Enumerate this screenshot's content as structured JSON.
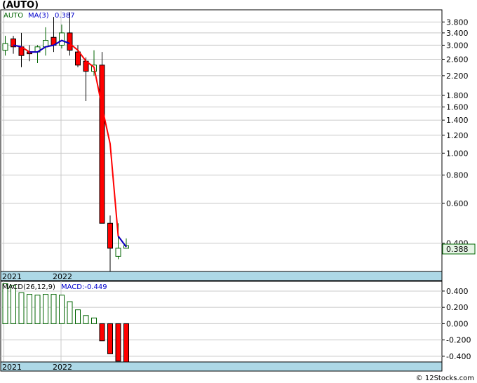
{
  "page": {
    "title": "(AUTO)",
    "copyright": "© 12Stocks.com"
  },
  "chart_data": [
    {
      "type": "candlestick",
      "scale": "log",
      "legend": {
        "symbol": "AUTO",
        "ma_label": "MA(3)",
        "ma_value": "0.387"
      },
      "last_price_label": "0.388",
      "ylim": [
        0.3,
        4.3
      ],
      "yticks": [
        "3.800",
        "3.400",
        "3.000",
        "2.600",
        "2.200",
        "1.800",
        "1.600",
        "1.400",
        "1.200",
        "1.000",
        "0.800",
        "0.600",
        "0.400"
      ],
      "ytick_values": [
        3.8,
        3.4,
        3.0,
        2.6,
        2.2,
        1.8,
        1.6,
        1.4,
        1.2,
        1.0,
        0.8,
        0.6,
        0.4
      ],
      "xticks": [
        "2021",
        "2022"
      ],
      "candles": [
        {
          "o": 2.85,
          "h": 3.3,
          "l": 2.7,
          "c": 3.05
        },
        {
          "o": 3.2,
          "h": 3.3,
          "l": 2.75,
          "c": 2.95
        },
        {
          "o": 2.95,
          "h": 3.4,
          "l": 2.4,
          "c": 2.7
        },
        {
          "o": 2.8,
          "h": 3.0,
          "l": 2.55,
          "c": 2.75
        },
        {
          "o": 2.8,
          "h": 3.0,
          "l": 2.5,
          "c": 2.95
        },
        {
          "o": 2.95,
          "h": 3.6,
          "l": 2.7,
          "c": 3.15
        },
        {
          "o": 3.25,
          "h": 4.0,
          "l": 2.8,
          "c": 3.0
        },
        {
          "o": 3.0,
          "h": 3.7,
          "l": 2.9,
          "c": 3.4
        },
        {
          "o": 3.4,
          "h": 4.2,
          "l": 2.7,
          "c": 2.85
        },
        {
          "o": 2.8,
          "h": 3.0,
          "l": 2.4,
          "c": 2.45
        },
        {
          "o": 2.55,
          "h": 2.65,
          "l": 1.7,
          "c": 2.3
        },
        {
          "o": 2.3,
          "h": 2.85,
          "l": 2.2,
          "c": 2.45
        },
        {
          "o": 2.45,
          "h": 2.8,
          "l": 0.49,
          "c": 0.49
        },
        {
          "o": 0.49,
          "h": 0.53,
          "l": 0.3,
          "c": 0.38
        },
        {
          "o": 0.35,
          "h": 0.49,
          "l": 0.34,
          "c": 0.38
        },
        {
          "o": 0.38,
          "h": 0.42,
          "l": 0.38,
          "c": 0.39
        }
      ],
      "ma3": [
        null,
        3.0,
        2.95,
        2.8,
        2.8,
        2.95,
        3.0,
        3.15,
        3.05,
        2.85,
        2.55,
        2.4,
        1.6,
        1.1,
        0.43,
        0.385
      ],
      "ma3_blue_segments": [
        [
          1,
          2
        ],
        [
          3,
          8
        ],
        [
          14,
          15
        ]
      ],
      "colors": {
        "up": "#ffffff",
        "up_stroke": "#006400",
        "down": "#ff0000",
        "ma_red": "#ff0000",
        "ma_blue": "#0000cc",
        "axis_band": "#add8e6"
      }
    },
    {
      "type": "bar",
      "legend": {
        "label": "MACD(26,12,9)",
        "value_label": "MACD:-0.449"
      },
      "ylim": [
        -0.47,
        0.52
      ],
      "yticks": [
        "0.400",
        "0.200",
        "0.000",
        "-0.200",
        "-0.400"
      ],
      "ytick_values": [
        0.4,
        0.2,
        0.0,
        -0.2,
        -0.4
      ],
      "xticks": [
        "2021",
        "2022"
      ],
      "values": [
        0.49,
        0.47,
        0.38,
        0.36,
        0.35,
        0.36,
        0.36,
        0.35,
        0.27,
        0.17,
        0.1,
        0.07,
        -0.21,
        -0.37,
        -0.46,
        -0.47,
        -0.449
      ]
    }
  ]
}
